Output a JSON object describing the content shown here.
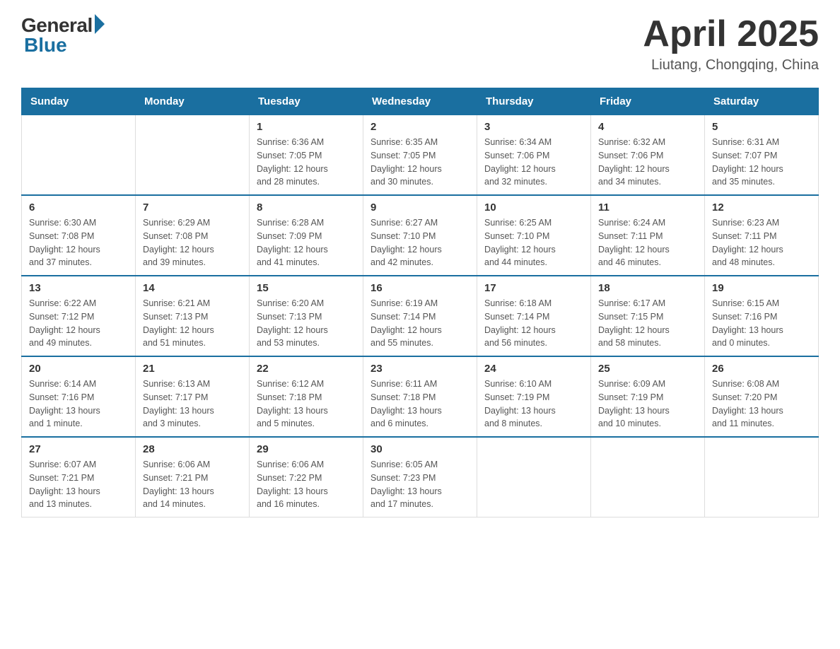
{
  "logo": {
    "general": "General",
    "blue": "Blue"
  },
  "header": {
    "month": "April 2025",
    "location": "Liutang, Chongqing, China"
  },
  "weekdays": [
    "Sunday",
    "Monday",
    "Tuesday",
    "Wednesday",
    "Thursday",
    "Friday",
    "Saturday"
  ],
  "weeks": [
    [
      {
        "day": "",
        "info": ""
      },
      {
        "day": "",
        "info": ""
      },
      {
        "day": "1",
        "info": "Sunrise: 6:36 AM\nSunset: 7:05 PM\nDaylight: 12 hours\nand 28 minutes."
      },
      {
        "day": "2",
        "info": "Sunrise: 6:35 AM\nSunset: 7:05 PM\nDaylight: 12 hours\nand 30 minutes."
      },
      {
        "day": "3",
        "info": "Sunrise: 6:34 AM\nSunset: 7:06 PM\nDaylight: 12 hours\nand 32 minutes."
      },
      {
        "day": "4",
        "info": "Sunrise: 6:32 AM\nSunset: 7:06 PM\nDaylight: 12 hours\nand 34 minutes."
      },
      {
        "day": "5",
        "info": "Sunrise: 6:31 AM\nSunset: 7:07 PM\nDaylight: 12 hours\nand 35 minutes."
      }
    ],
    [
      {
        "day": "6",
        "info": "Sunrise: 6:30 AM\nSunset: 7:08 PM\nDaylight: 12 hours\nand 37 minutes."
      },
      {
        "day": "7",
        "info": "Sunrise: 6:29 AM\nSunset: 7:08 PM\nDaylight: 12 hours\nand 39 minutes."
      },
      {
        "day": "8",
        "info": "Sunrise: 6:28 AM\nSunset: 7:09 PM\nDaylight: 12 hours\nand 41 minutes."
      },
      {
        "day": "9",
        "info": "Sunrise: 6:27 AM\nSunset: 7:10 PM\nDaylight: 12 hours\nand 42 minutes."
      },
      {
        "day": "10",
        "info": "Sunrise: 6:25 AM\nSunset: 7:10 PM\nDaylight: 12 hours\nand 44 minutes."
      },
      {
        "day": "11",
        "info": "Sunrise: 6:24 AM\nSunset: 7:11 PM\nDaylight: 12 hours\nand 46 minutes."
      },
      {
        "day": "12",
        "info": "Sunrise: 6:23 AM\nSunset: 7:11 PM\nDaylight: 12 hours\nand 48 minutes."
      }
    ],
    [
      {
        "day": "13",
        "info": "Sunrise: 6:22 AM\nSunset: 7:12 PM\nDaylight: 12 hours\nand 49 minutes."
      },
      {
        "day": "14",
        "info": "Sunrise: 6:21 AM\nSunset: 7:13 PM\nDaylight: 12 hours\nand 51 minutes."
      },
      {
        "day": "15",
        "info": "Sunrise: 6:20 AM\nSunset: 7:13 PM\nDaylight: 12 hours\nand 53 minutes."
      },
      {
        "day": "16",
        "info": "Sunrise: 6:19 AM\nSunset: 7:14 PM\nDaylight: 12 hours\nand 55 minutes."
      },
      {
        "day": "17",
        "info": "Sunrise: 6:18 AM\nSunset: 7:14 PM\nDaylight: 12 hours\nand 56 minutes."
      },
      {
        "day": "18",
        "info": "Sunrise: 6:17 AM\nSunset: 7:15 PM\nDaylight: 12 hours\nand 58 minutes."
      },
      {
        "day": "19",
        "info": "Sunrise: 6:15 AM\nSunset: 7:16 PM\nDaylight: 13 hours\nand 0 minutes."
      }
    ],
    [
      {
        "day": "20",
        "info": "Sunrise: 6:14 AM\nSunset: 7:16 PM\nDaylight: 13 hours\nand 1 minute."
      },
      {
        "day": "21",
        "info": "Sunrise: 6:13 AM\nSunset: 7:17 PM\nDaylight: 13 hours\nand 3 minutes."
      },
      {
        "day": "22",
        "info": "Sunrise: 6:12 AM\nSunset: 7:18 PM\nDaylight: 13 hours\nand 5 minutes."
      },
      {
        "day": "23",
        "info": "Sunrise: 6:11 AM\nSunset: 7:18 PM\nDaylight: 13 hours\nand 6 minutes."
      },
      {
        "day": "24",
        "info": "Sunrise: 6:10 AM\nSunset: 7:19 PM\nDaylight: 13 hours\nand 8 minutes."
      },
      {
        "day": "25",
        "info": "Sunrise: 6:09 AM\nSunset: 7:19 PM\nDaylight: 13 hours\nand 10 minutes."
      },
      {
        "day": "26",
        "info": "Sunrise: 6:08 AM\nSunset: 7:20 PM\nDaylight: 13 hours\nand 11 minutes."
      }
    ],
    [
      {
        "day": "27",
        "info": "Sunrise: 6:07 AM\nSunset: 7:21 PM\nDaylight: 13 hours\nand 13 minutes."
      },
      {
        "day": "28",
        "info": "Sunrise: 6:06 AM\nSunset: 7:21 PM\nDaylight: 13 hours\nand 14 minutes."
      },
      {
        "day": "29",
        "info": "Sunrise: 6:06 AM\nSunset: 7:22 PM\nDaylight: 13 hours\nand 16 minutes."
      },
      {
        "day": "30",
        "info": "Sunrise: 6:05 AM\nSunset: 7:23 PM\nDaylight: 13 hours\nand 17 minutes."
      },
      {
        "day": "",
        "info": ""
      },
      {
        "day": "",
        "info": ""
      },
      {
        "day": "",
        "info": ""
      }
    ]
  ]
}
